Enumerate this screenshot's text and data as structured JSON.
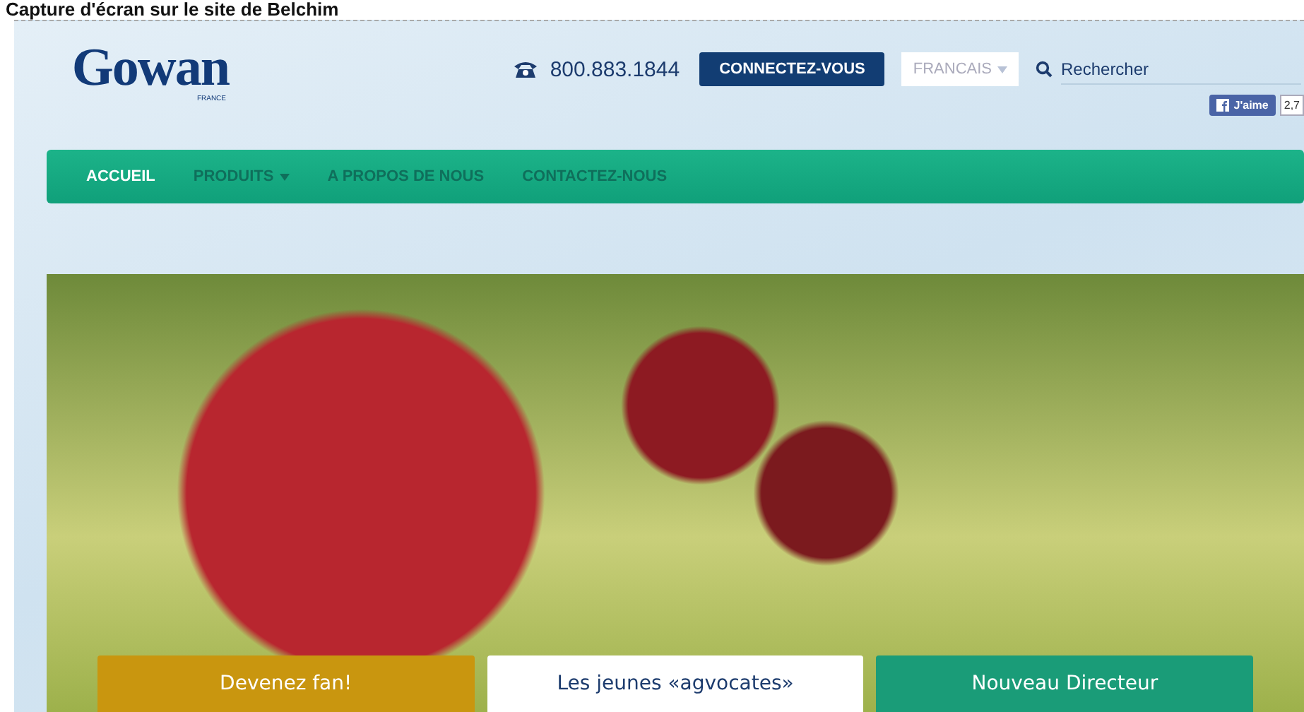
{
  "caption": "Capture d'écran sur le site de Belchim",
  "logo": {
    "name": "Gowan",
    "sub": "FRANCE"
  },
  "header": {
    "phone": "800.883.1844",
    "login": "CONNECTEZ-VOUS",
    "language": "FRANCAIS",
    "search_placeholder": "Rechercher",
    "like": "J'aime",
    "like_count": "2,7"
  },
  "nav": [
    {
      "label": "ACCUEIL",
      "selected": true,
      "dropdown": false
    },
    {
      "label": "PRODUITS",
      "selected": false,
      "dropdown": true
    },
    {
      "label": "A PROPOS DE NOUS",
      "selected": false,
      "dropdown": false
    },
    {
      "label": "CONTACTEZ-NOUS",
      "selected": false,
      "dropdown": false
    }
  ],
  "hero_tabs": [
    {
      "label": "Devenez fan!",
      "selected": false,
      "color": "#c9960f"
    },
    {
      "label": "Les jeunes «agvocates»",
      "selected": true,
      "color": "#ffffff"
    },
    {
      "label": "Nouveau Directeur",
      "selected": false,
      "color": "#1a9c78"
    }
  ]
}
